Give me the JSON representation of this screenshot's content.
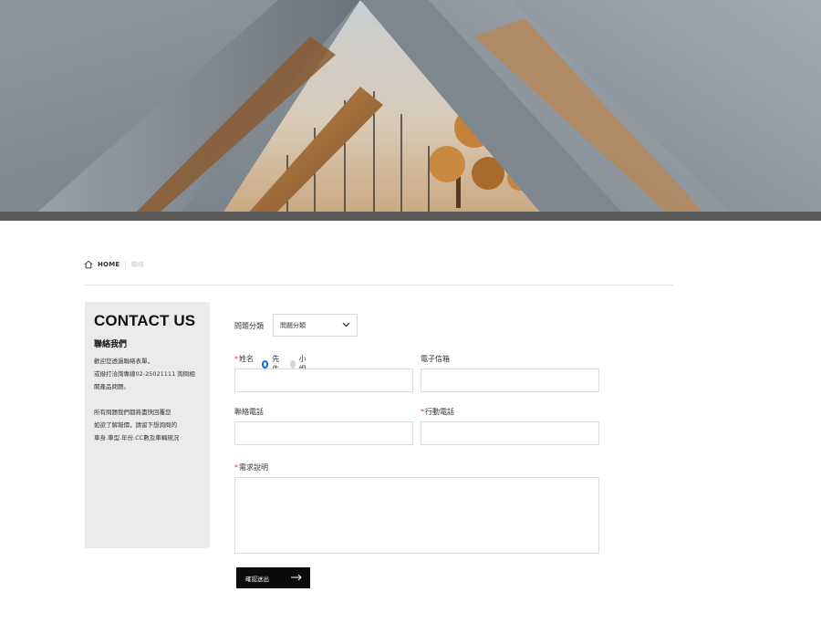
{
  "hero": {
    "image": "architectural-triangle-concrete-building-with-autumn-tree"
  },
  "breadcrumb": {
    "home": "HOME",
    "current": "聯絡"
  },
  "sidebar": {
    "title_en": "CONTACT US",
    "title_zh": "聯絡我們",
    "paragraph1_lines": [
      "歡迎您透過聯絡表單，",
      "或撥打洽詢專線02-25021111 詢問相",
      "關產品問題。"
    ],
    "paragraph2_lines": [
      "所有問題我們都將盡快回覆您",
      "如欲了解報價，請留下想詢問的",
      "車身.車型.年份.CC數及車輛現況"
    ]
  },
  "form": {
    "category_label": "問題分類",
    "category_value": "問題分類",
    "required_mark": "*",
    "name_label": "姓名",
    "radio_mr": "先生",
    "radio_ms": "小姐",
    "email_label": "電子信箱",
    "phone_label": "聯絡電話",
    "mobile_label": "行動電話",
    "description_label": "需求說明",
    "submit_label": "確認送出"
  }
}
